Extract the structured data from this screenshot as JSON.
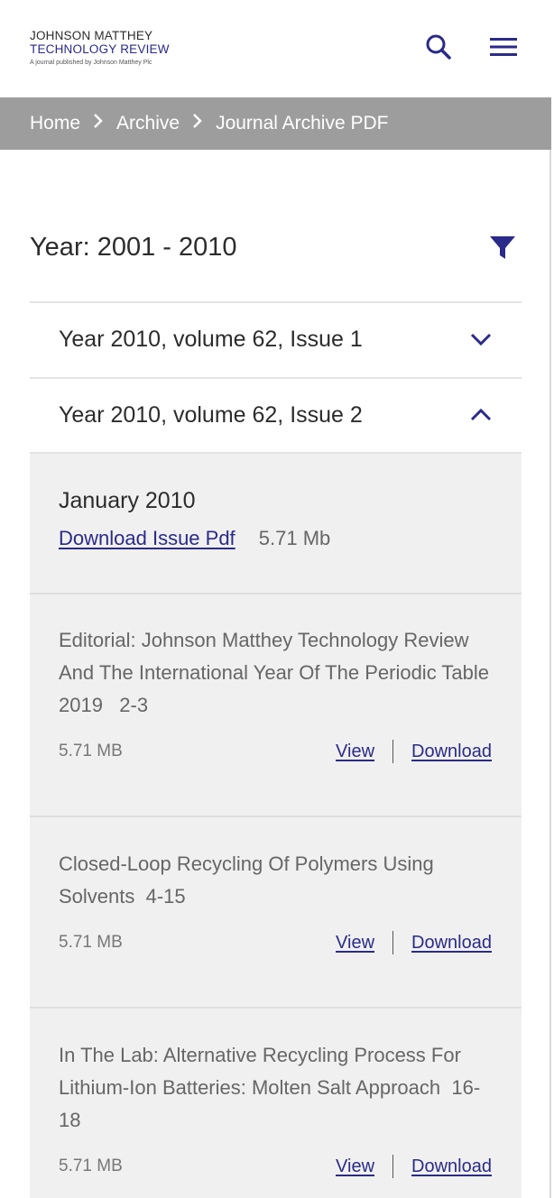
{
  "logo": {
    "line1": "JOHNSON MATTHEY",
    "line2": "TECHNOLOGY REVIEW",
    "tagline": "A journal published by Johnson Matthey Plc"
  },
  "header": {
    "search_icon": "search-icon",
    "menu_icon": "hamburger-menu-icon"
  },
  "breadcrumb": {
    "items": [
      "Home",
      "Archive",
      "Journal Archive PDF"
    ],
    "separator": ">"
  },
  "filter": {
    "title": "Year: 2001 - 2010",
    "icon": "filter-icon"
  },
  "accordion": [
    {
      "title": "Year 2010, volume 62, Issue 1",
      "expanded": false
    },
    {
      "title": "Year 2010, volume 62, Issue 2",
      "expanded": true
    }
  ],
  "issue": {
    "month": "January 2010",
    "download_label": "Download Issue Pdf",
    "size": "5.71 Mb"
  },
  "articles": [
    {
      "title": "Editorial: Johnson Matthey Technology Review And The International Year Of The Periodic Table 2019",
      "pages": "2-3",
      "size": "5.71 MB",
      "view": "View",
      "download": "Download"
    },
    {
      "title": "Closed-Loop Recycling Of Polymers Using Solvents",
      "pages": "4-15",
      "size": "5.71 MB",
      "view": "View",
      "download": "Download"
    },
    {
      "title": "In The Lab: Alternative Recycling Process For Lithium-Ion Batteries: Molten Salt Approach",
      "pages": "16-18",
      "size": "5.71 MB",
      "view": "View",
      "download": "Download"
    }
  ],
  "colors": {
    "accent": "#2a2a8a",
    "breadcrumb_bg": "#9d9d9d",
    "panel_bg": "#f0f0f0"
  }
}
